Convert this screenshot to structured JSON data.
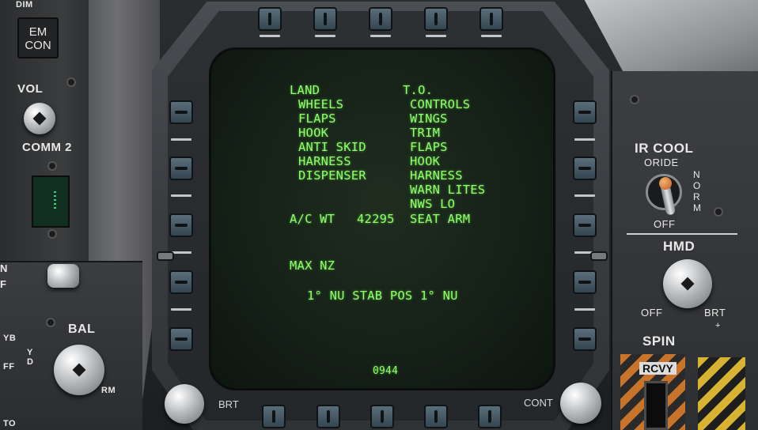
{
  "left_console": {
    "dim_label": "DIM",
    "emcon_line1": "EM",
    "emcon_line2": "CON",
    "vol_label": "VOL",
    "comm2_label": "COMM 2",
    "bal_label": "BAL",
    "side_letters_left": "YB",
    "side_letters_right": "Y D",
    "partial_a": "N",
    "partial_b": "F",
    "partial_c": "FF",
    "partial_d": "RM",
    "partial_e": "TO"
  },
  "right_console": {
    "ir_cool_label": "IR COOL",
    "oride_label": "ORIDE",
    "norm_label": "N O R M",
    "off_label": "OFF",
    "hmd_label": "HMD",
    "hmd_off": "OFF",
    "hmd_brt": "BRT",
    "plus": "+",
    "spin_label": "SPIN",
    "rcvy_label": "RCVY"
  },
  "bezel": {
    "brt_label": "BRT",
    "cont_label": "CONT"
  },
  "display": {
    "land_header": "LAND",
    "land_items": [
      "WHEELS",
      "FLAPS",
      "HOOK",
      "ANTI SKID",
      "HARNESS",
      "DISPENSER"
    ],
    "to_header": "T.O.",
    "to_items": [
      "CONTROLS",
      "WINGS",
      "TRIM",
      "FLAPS",
      "HOOK",
      "HARNESS",
      "WARN LITES",
      "NWS LO",
      "SEAT ARM"
    ],
    "ac_wt_label": "A/C WT",
    "ac_wt_value": "42295",
    "max_nz_label": "MAX NZ",
    "stab_pos": "1° NU STAB POS 1° NU",
    "time": "0944"
  },
  "colors": {
    "display_text": "#8fff6a",
    "display_bg": "#152017"
  }
}
